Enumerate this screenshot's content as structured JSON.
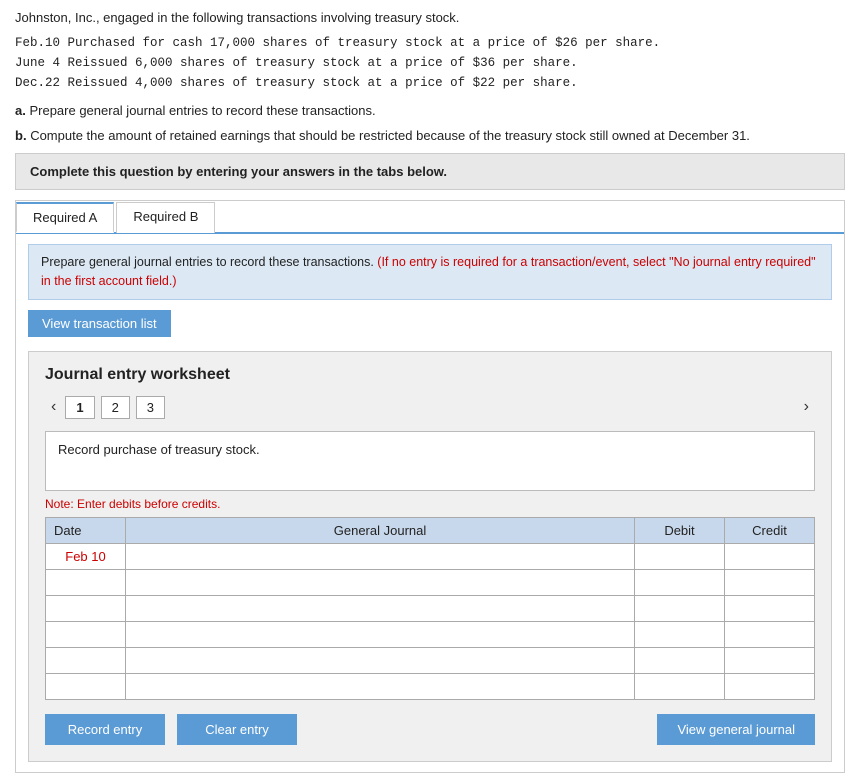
{
  "intro": {
    "line1": "Johnston, Inc., engaged in the following transactions involving treasury stock.",
    "transactions": [
      "Feb.10  Purchased for cash 17,000 shares of treasury stock at a price of $26 per share.",
      "June 4  Reissued 6,000 shares of treasury stock at a price of $36 per share.",
      "Dec.22  Reissued 4,000 shares of treasury stock at a price of $22 per share."
    ],
    "part_a_label": "a.",
    "part_a_text": "Prepare general journal entries to record these transactions.",
    "part_b_label": "b.",
    "part_b_text": "Compute the amount of retained earnings that should be restricted because of the treasury stock still owned at December 31."
  },
  "complete_box": {
    "text": "Complete this question by entering your answers in the tabs below."
  },
  "tabs": [
    {
      "id": "tab-a",
      "label": "Required A"
    },
    {
      "id": "tab-b",
      "label": "Required B"
    }
  ],
  "active_tab": "Required A",
  "info_box": {
    "text_before": "Prepare general journal entries to record these transactions.",
    "text_red": " (If no entry is required for a transaction/event, select \"No journal entry required\" in the first account field.)"
  },
  "view_transaction_btn": "View transaction list",
  "worksheet": {
    "title": "Journal entry worksheet",
    "pages": [
      {
        "number": "1"
      },
      {
        "number": "2"
      },
      {
        "number": "3"
      }
    ],
    "current_page": 1,
    "transaction_description": "Record purchase of treasury stock.",
    "note": "Note: Enter debits before credits.",
    "table": {
      "headers": [
        "Date",
        "General Journal",
        "Debit",
        "Credit"
      ],
      "rows": [
        {
          "date": "Feb 10",
          "journal": "",
          "debit": "",
          "credit": ""
        },
        {
          "date": "",
          "journal": "",
          "debit": "",
          "credit": ""
        },
        {
          "date": "",
          "journal": "",
          "debit": "",
          "credit": ""
        },
        {
          "date": "",
          "journal": "",
          "debit": "",
          "credit": ""
        },
        {
          "date": "",
          "journal": "",
          "debit": "",
          "credit": ""
        },
        {
          "date": "",
          "journal": "",
          "debit": "",
          "credit": ""
        }
      ]
    }
  },
  "buttons": {
    "record_entry": "Record entry",
    "clear_entry": "Clear entry",
    "view_general_journal": "View general journal"
  }
}
